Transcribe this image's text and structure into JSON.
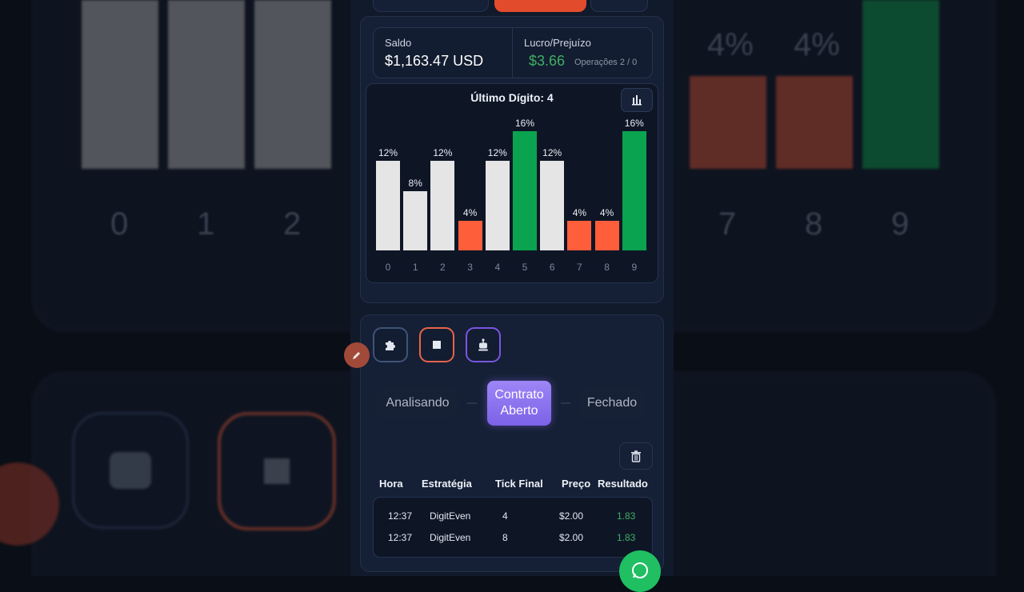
{
  "stats": {
    "balance_label": "Saldo",
    "balance_value": "$1,163.47 USD",
    "profit_label": "Lucro/Prejuízo",
    "profit_value": "$3.66",
    "ops_text": "Operações 2 / 0"
  },
  "chart_data": {
    "type": "bar",
    "title": "Último Dígito: 4",
    "categories": [
      "0",
      "1",
      "2",
      "3",
      "4",
      "5",
      "6",
      "7",
      "8",
      "9"
    ],
    "values": [
      12,
      8,
      12,
      4,
      12,
      16,
      12,
      4,
      4,
      16
    ],
    "labels": [
      "12%",
      "8%",
      "12%",
      "4%",
      "12%",
      "16%",
      "12%",
      "4%",
      "4%",
      "16%"
    ],
    "colors": [
      "#e5e5e5",
      "#e5e5e5",
      "#e5e5e5",
      "#ff5e3a",
      "#e5e5e5",
      "#0aa34f",
      "#e5e5e5",
      "#ff5e3a",
      "#ff5e3a",
      "#0aa34f"
    ],
    "ylim": [
      0,
      16
    ]
  },
  "controls": {
    "buttons": [
      {
        "icon": "puzzle-icon",
        "border": "#3f5377"
      },
      {
        "icon": "stop-icon",
        "border": "#e8634a"
      },
      {
        "icon": "robot-icon",
        "border": "#7a55e0"
      }
    ]
  },
  "status_steps": {
    "analyzing": "Analisando",
    "contract_line1": "Contrato",
    "contract_line2": "Aberto",
    "closed": "Fechado"
  },
  "table": {
    "headers": {
      "time": "Hora",
      "strategy": "Estratégia",
      "final_tick": "Tick Final",
      "price": "Preço",
      "result": "Resultado"
    },
    "rows": [
      {
        "time": "12:37",
        "strategy": "DigitEven",
        "final_tick": "4",
        "price": "$2.00",
        "result": "1.83"
      },
      {
        "time": "12:37",
        "strategy": "DigitEven",
        "final_tick": "8",
        "price": "$2.00",
        "result": "1.83"
      }
    ]
  },
  "background": {
    "pct_7": "4%",
    "pct_8": "4%",
    "digit_0": "0",
    "digit_1": "1",
    "digit_2": "2",
    "digit_7": "7",
    "digit_8": "8",
    "digit_9": "9"
  },
  "colors": {
    "accent_green": "#3fae62",
    "accent_purple": "#8b72f0",
    "accent_orange": "#e8634a",
    "whatsapp": "#1fbf62"
  }
}
